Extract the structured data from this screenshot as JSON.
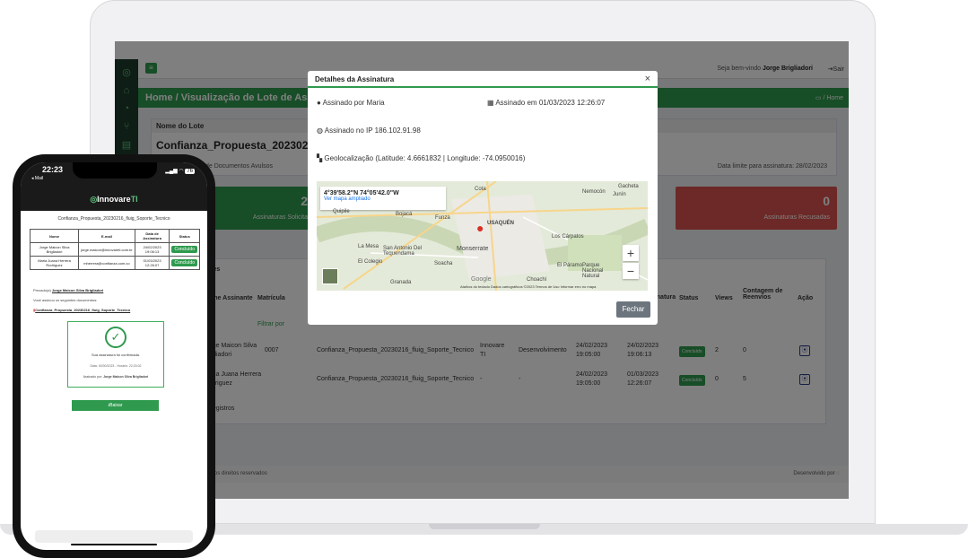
{
  "desktop": {
    "topbar": {
      "welcome_prefix": "Seja bem-vindo",
      "user": "Jorge Brigliadori",
      "logout": "Sair"
    },
    "header": {
      "title": "Home / Visualização de Lote de Assina",
      "breadcrumb": "/ Home"
    },
    "lote": {
      "label": "Nome do Lote",
      "name": "Confianza_Propuesta_20230216_f",
      "type_text": "de Documentos Avulsos",
      "deadline": "Data limite para assinatura: 28/02/2023"
    },
    "stats": [
      {
        "value": "2",
        "label": "Assinaturas Solicita",
        "color": "#2f9a4e"
      },
      {
        "value": "0",
        "label": "Assinaturas Recusadas",
        "color": "#d9534f"
      }
    ],
    "table": {
      "section_label": "antes",
      "filter_label": "Filtrar por",
      "headers": [
        "Nome Assinante",
        "Matrícula",
        "",
        "",
        "",
        "",
        "de Assinatura",
        "Status",
        "Views",
        "Contagem de Reenvios",
        "Ação"
      ],
      "rows": [
        {
          "name": "Jorge Maicon Silva Brigliadori",
          "matricula": "0007",
          "documento": "Confianza_Propuesta_20230216_fluig_Soporte_Tecnico",
          "empresa": "Innovare TI",
          "area": "Desenvolvimento",
          "envio": "24/02/2023 19:05:00",
          "assinatura": "24/02/2023 19:06:13",
          "status": "Concluído",
          "views": "2",
          "reenvios": "0"
        },
        {
          "name": "Maria Juana Herrera Rodriguez",
          "matricula": "",
          "documento": "Confianza_Propuesta_20230216_fluig_Soporte_Tecnico",
          "empresa": "-",
          "area": "-",
          "envio": "24/02/2023 19:05:00",
          "assinatura": "01/03/2023 12:26:07",
          "status": "Concluído",
          "views": "0",
          "reenvios": "5"
        }
      ],
      "footer_count": "2 de registros"
    },
    "footer": {
      "left": "ntos os direitos reservados",
      "right": "Desenvolvido por"
    },
    "modal": {
      "title": "Detalhes da Assinatura",
      "close": "×",
      "signed_by": "Assinado por Maria",
      "signed_at": "Assinado em 01/03/2023 12:26:07",
      "ip": "Assinado no IP 186.102.91.98",
      "geo": "Geolocalização (Latitude: 4.6661832 | Longitude: -74.0950016)",
      "map": {
        "coords": "4°39'58.2\"N 74°05'42.0\"W",
        "link": "Ver mapa ampliado",
        "labels": [
          "Cota",
          "Nemocón",
          "Gacheta",
          "Junín",
          "Quipile",
          "Bojacá",
          "Funza",
          "USAQUÉN",
          "La Mesa",
          "San Antonio Del Tequendama",
          "Monserrate",
          "Los Cárpatos",
          "El Colegio",
          "Soacha",
          "El Páramo",
          "Parque Nacional Natural",
          "Granada",
          "Choachí",
          "Google"
        ],
        "attribution": "Atalhos do teclado   Dados cartográficos ©2023   Termos de Uso   Informar erro no mapa"
      },
      "close_button": "Fechar"
    }
  },
  "phone": {
    "time": "22:23",
    "back": "◂ Mail",
    "battery": "76",
    "brand": "Innovare",
    "brand_suffix": "TI",
    "doc_title": "Confianza_Propuesta_20230216_fluig_Soporte_Tecnico",
    "table_headers": [
      "Nome",
      "E-mail",
      "Data de Assinatura",
      "Status"
    ],
    "rows": [
      {
        "name": "Jorge Maicon Silva Brigliadori",
        "email": "jorge.maicon@innovareti.com.br",
        "date": "24/02/2023 19:06:13",
        "status": "Concluído"
      },
      {
        "name": "Maria Juana Herrera Rodriguez",
        "email": "mherrera@confianza.com.co",
        "date": "01/03/2023 12:26:07",
        "status": "Concluído"
      }
    ],
    "greeting_prefix": "Prezado(a)",
    "greeting_name": "Jorge Maicon Silva Brigliadori",
    "intro": "Você assinou os seguintes documentos:",
    "doc_link": "Confianza_Propuesta_20230216_fluig_Soporte_Tecnico",
    "confirm": "Sua assinatura foi confirmada.",
    "confirm_date": "Data: 00/00/2023 - Horário: 22:23:02",
    "signed_by_prefix": "Assinado por:",
    "signed_by": "Jorge Maicon Silva Brigliadori",
    "download": "Baixar"
  }
}
